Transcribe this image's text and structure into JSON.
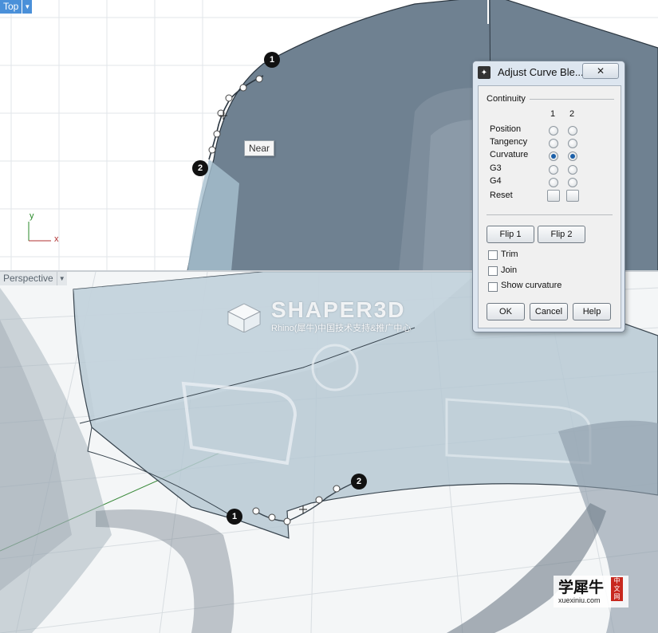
{
  "viewports": {
    "top": {
      "label": "Top",
      "axis_y": "y",
      "axis_x": "x"
    },
    "perspective": {
      "label": "Perspective"
    }
  },
  "markers": {
    "top_1": "1",
    "top_2": "2",
    "persp_1": "1",
    "persp_2": "2"
  },
  "tooltip": "Near",
  "watermark": {
    "brand": "SHAPER3D",
    "subtitle": "Rhino(犀牛)中国技术支持&推广中心"
  },
  "corner_logo": {
    "chinese": "学犀牛",
    "badge": "中文网",
    "url": "xuexiniu.com"
  },
  "dialog": {
    "title": "Adjust Curve Ble...",
    "close": "✕",
    "continuity_label": "Continuity",
    "col1": "1",
    "col2": "2",
    "rows": [
      {
        "label": "Position",
        "c1": false,
        "c2": false
      },
      {
        "label": "Tangency",
        "c1": false,
        "c2": false
      },
      {
        "label": "Curvature",
        "c1": true,
        "c2": true
      },
      {
        "label": "G3",
        "c1": false,
        "c2": false
      },
      {
        "label": "G4",
        "c1": false,
        "c2": false
      }
    ],
    "reset_label": "Reset",
    "flip1": "Flip 1",
    "flip2": "Flip 2",
    "trim": {
      "label": "Trim",
      "checked": false
    },
    "join": {
      "label": "Join",
      "checked": false
    },
    "show_curvature": {
      "label": "Show curvature",
      "checked": false
    },
    "ok": "OK",
    "cancel": "Cancel",
    "help": "Help"
  }
}
